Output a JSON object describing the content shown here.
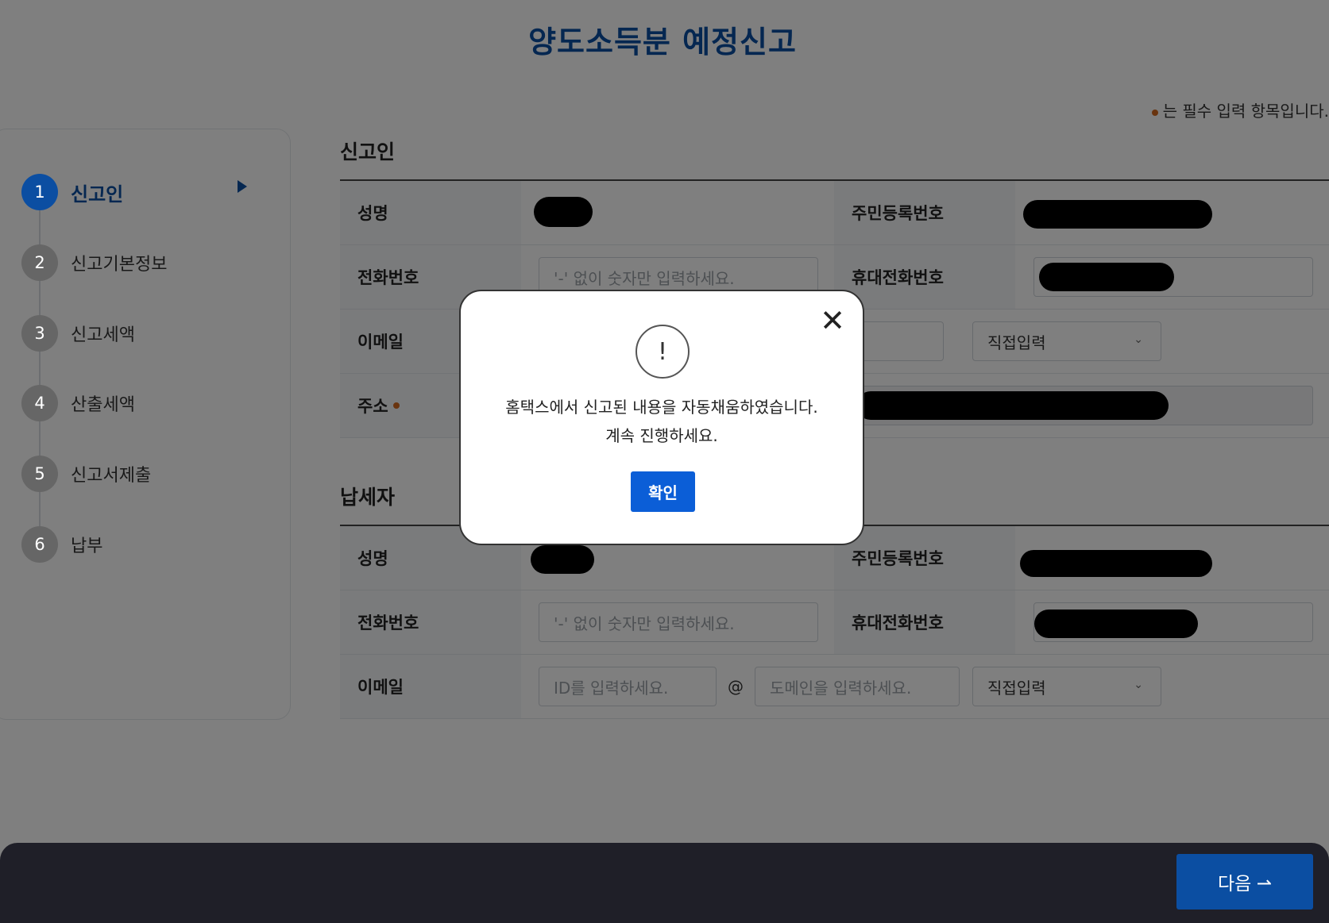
{
  "page": {
    "title": "양도소득분 예정신고",
    "required_note": "는 필수 입력 항목입니다."
  },
  "steps": [
    {
      "num": "1",
      "label": "신고인"
    },
    {
      "num": "2",
      "label": "신고기본정보"
    },
    {
      "num": "3",
      "label": "신고세액"
    },
    {
      "num": "4",
      "label": "산출세액"
    },
    {
      "num": "5",
      "label": "신고서제출"
    },
    {
      "num": "6",
      "label": "납부"
    }
  ],
  "reporter": {
    "section_title": "신고인",
    "name_label": "성명",
    "ssn_label": "주민등록번호",
    "phone_label": "전화번호",
    "phone_placeholder": "'-' 없이  숫자만 입력하세요.",
    "mobile_label": "휴대전화번호",
    "email_label": "이메일",
    "email_domain_select": "직접입력",
    "address_label": "주소"
  },
  "taxpayer": {
    "section_title": "납세자",
    "name_label": "성명",
    "ssn_label": "주민등록번호",
    "phone_label": "전화번호",
    "phone_placeholder": "'-' 없이  숫자만 입력하세요.",
    "mobile_label": "휴대전화번호",
    "email_label": "이메일",
    "email_id_placeholder": "ID를 입력하세요.",
    "email_at": "@",
    "email_domain_placeholder": "도메인을 입력하세요.",
    "email_domain_select": "직접입력"
  },
  "modal": {
    "icon": "!",
    "close": "✕",
    "line1": "홈택스에서 신고된 내용을 자동채움하였습니다.",
    "line2": "계속 진행하세요.",
    "ok_label": "확인"
  },
  "footer": {
    "next_label": "다음 ⇀"
  },
  "colors": {
    "primary": "#0b4ea2",
    "required_dot": "#d2691e",
    "modal_button": "#0b5ed7"
  }
}
